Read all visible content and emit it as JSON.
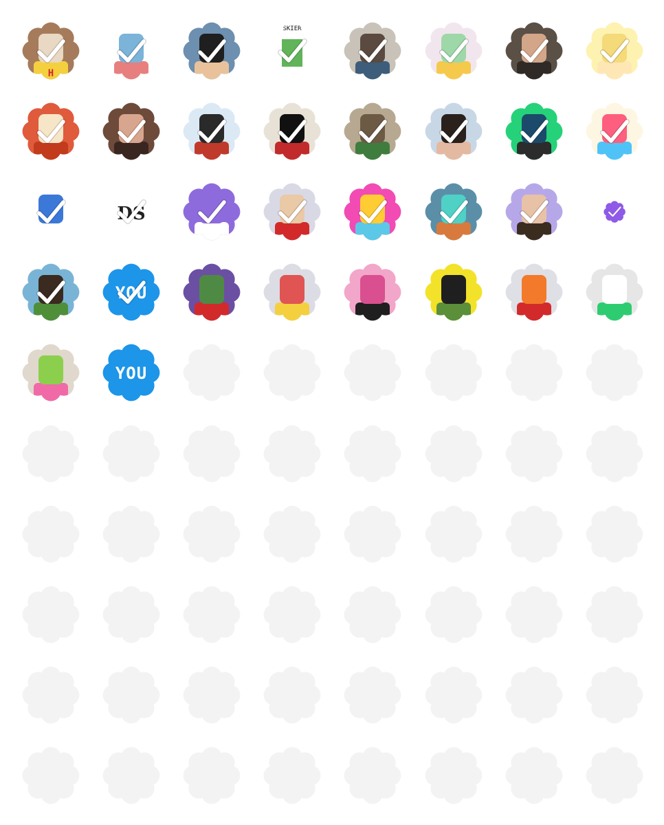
{
  "grid": {
    "columns": 8,
    "rows": 10,
    "filled": [
      {
        "name": "pixel-hat-yellow-shirt",
        "colors": [
          "#a67b5b",
          "#e8d8c4",
          "#f4d03f"
        ],
        "letter": "H",
        "check": true
      },
      {
        "name": "floral-collage",
        "colors": [
          "#ffffff",
          "#7bb3d9",
          "#e77f7f"
        ],
        "check": true
      },
      {
        "name": "pixel-man-black-hair",
        "colors": [
          "#6d8fb0",
          "#1f1f1f",
          "#e9c29b"
        ],
        "check": true
      },
      {
        "name": "skier-sketch",
        "colors": [
          "#ffffff",
          "#61b45a",
          "#d94f8f"
        ],
        "text": "SKIER",
        "check": true
      },
      {
        "name": "photo-man-bridge",
        "colors": [
          "#c9c2b8",
          "#5b4a3f",
          "#3d5d7b"
        ],
        "check": true
      },
      {
        "name": "crown-cartoon-smoker",
        "colors": [
          "#f2e6ee",
          "#9fd8a8",
          "#f5c94c"
        ],
        "check": true
      },
      {
        "name": "photo-man-smiling",
        "colors": [
          "#5a5046",
          "#d3a68a",
          "#2f2a26"
        ],
        "check": true
      },
      {
        "name": "pixel-blonde-woman",
        "colors": [
          "#fdf2b0",
          "#f5da7a",
          "#ffe7b5"
        ],
        "check": true
      },
      {
        "name": "orange-hair-cartoon",
        "colors": [
          "#e05a3c",
          "#f7e5c8",
          "#c23b1d"
        ],
        "check": true
      },
      {
        "name": "photo-brunette-woman",
        "colors": [
          "#6e4a3a",
          "#d8a58e",
          "#3a2620"
        ],
        "check": true
      },
      {
        "name": "pirate-skull-snow",
        "colors": [
          "#dbe9f5",
          "#2a2a2a",
          "#c03a2b"
        ],
        "check": true
      },
      {
        "name": "samurai-dots",
        "colors": [
          "#e8e2d6",
          "#111111",
          "#c22b2b"
        ],
        "check": true
      },
      {
        "name": "pixel-helmet-green",
        "colors": [
          "#b7a891",
          "#6d5a45",
          "#3f7d3f"
        ],
        "check": true
      },
      {
        "name": "photo-man-dark-hair",
        "colors": [
          "#c8d7e5",
          "#2a211d",
          "#e4b9a2"
        ],
        "check": true
      },
      {
        "name": "green-neon-silhouette",
        "colors": [
          "#25d27a",
          "#1b4a6b",
          "#2c2c2c"
        ],
        "check": true
      },
      {
        "name": "rainbow-letter-d",
        "colors": [
          "#fdf6e3",
          "#ff5f7e",
          "#4fc3f7"
        ],
        "check": true
      },
      {
        "name": "blue-drop-face",
        "colors": [
          "#ffffff",
          "#3c78d8",
          "#ffffff"
        ],
        "check": true
      },
      {
        "name": "ds-logo",
        "colors": [
          "#ffffff",
          "#222222",
          "#8e5ae6"
        ],
        "text": "DS",
        "check": true
      },
      {
        "name": "purple-verified-badge",
        "colors": [
          "#8e6bdc",
          "#8e6bdc",
          "#ffffff"
        ],
        "check": true
      },
      {
        "name": "pixel-sunglasses-man",
        "colors": [
          "#d9d9e6",
          "#e9c9a6",
          "#d22a2a"
        ],
        "check": true
      },
      {
        "name": "pink-helmet-toy",
        "colors": [
          "#f24bb3",
          "#ffcc33",
          "#5bc8e8"
        ],
        "check": true
      },
      {
        "name": "teal-monster-painting",
        "colors": [
          "#5b8fa8",
          "#4fd1c5",
          "#d87a3d"
        ],
        "check": true
      },
      {
        "name": "pixel-man-lavender",
        "colors": [
          "#b6a8e8",
          "#e8c2a6",
          "#3a2c1f"
        ],
        "check": true
      },
      {
        "name": "mini-purple-badge",
        "colors": [
          "#ffffff",
          "#8e5ae6",
          "#ffffff"
        ],
        "check": true,
        "mini": true
      },
      {
        "name": "pixel-bearded-man",
        "colors": [
          "#79b4d6",
          "#3a2a1f",
          "#4f8f3a"
        ],
        "check": true
      },
      {
        "name": "you-badge-checked",
        "colors": [
          "#1d95e8",
          "#1d95e8",
          "#ffffff"
        ],
        "text": "YOU",
        "check": true
      },
      {
        "name": "green-orc-purple",
        "colors": [
          "#6b4fa3",
          "#4f8a45",
          "#d22a2a"
        ],
        "check": false
      },
      {
        "name": "pixel-red-glasses",
        "colors": [
          "#dcdce4",
          "#e05454",
          "#f4d03f"
        ],
        "check": false
      },
      {
        "name": "pixel-pink-pig",
        "colors": [
          "#f2a6c9",
          "#d94f8f",
          "#1f1f1f"
        ],
        "check": false
      },
      {
        "name": "pixel-yellow-glasses",
        "colors": [
          "#f3e22a",
          "#1f1f1f",
          "#5b8f3a"
        ],
        "check": false
      },
      {
        "name": "pixel-orange-elf",
        "colors": [
          "#dfdfe6",
          "#f27a2a",
          "#d22a2a"
        ],
        "check": false
      },
      {
        "name": "pixel-white-yeti",
        "colors": [
          "#e6e6e6",
          "#ffffff",
          "#2ecc71"
        ],
        "check": false
      },
      {
        "name": "pixel-green-goblin",
        "colors": [
          "#e0d8cc",
          "#8ccf4d",
          "#f06aa8"
        ],
        "check": false
      },
      {
        "name": "you-badge",
        "colors": [
          "#1d95e8",
          "#1d95e8",
          "#ffffff"
        ],
        "text": "YOU",
        "check": false
      }
    ],
    "placeholder_color": "#f3f3f3",
    "placeholder_label": ""
  }
}
